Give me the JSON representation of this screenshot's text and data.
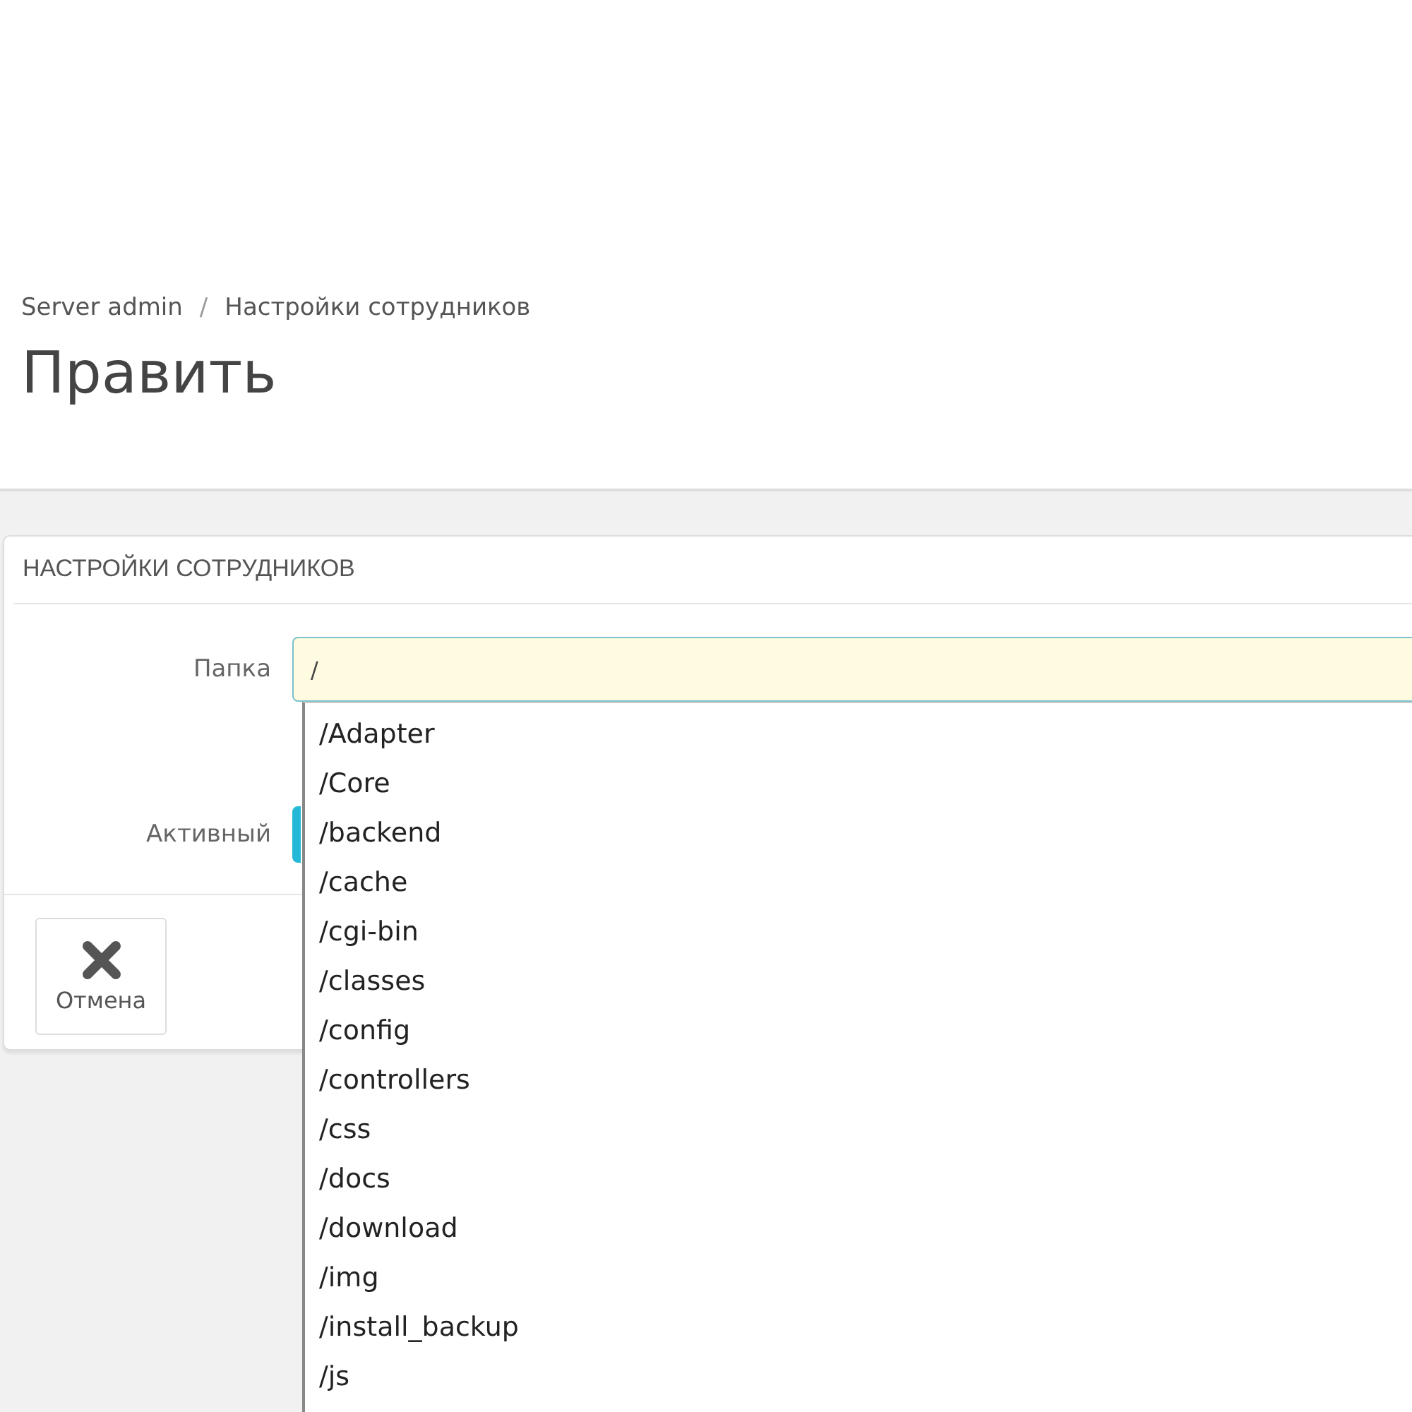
{
  "breadcrumb": [
    "Server admin",
    "Настройки сотрудников"
  ],
  "breadcrumb_separator": "/",
  "page_title": "Править",
  "panel": {
    "heading": "НАСТРОЙКИ СОТРУДНИКОВ",
    "fields": [
      {
        "kind": "text",
        "label": "Папка",
        "value": "/"
      },
      {
        "kind": "switch",
        "label": "Активный",
        "on": true
      }
    ],
    "buttons": [
      {
        "label": "Отмена"
      }
    ]
  },
  "dropdown": {
    "items": [
      {
        "label": "/Adapter"
      },
      {
        "label": "/Core"
      },
      {
        "label": "/backend"
      },
      {
        "label": "/cache"
      },
      {
        "label": "/cgi-bin"
      },
      {
        "label": "/classes"
      },
      {
        "label": "/config"
      },
      {
        "label": "/controllers"
      },
      {
        "label": "/css"
      },
      {
        "label": "/docs"
      },
      {
        "label": "/download"
      },
      {
        "label": "/img"
      },
      {
        "label": "/install_backup"
      },
      {
        "label": "/js"
      }
    ]
  }
}
